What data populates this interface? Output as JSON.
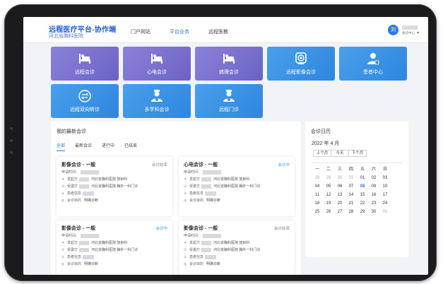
{
  "header": {
    "title": "远程医疗平台-协作端",
    "subtitle": "河北省胸科医院",
    "nav": [
      "门户网站",
      "平台业务",
      "远程医教"
    ],
    "active_nav": 1,
    "user": {
      "avatar_text": "刘",
      "dept": "会诊中心"
    }
  },
  "tiles": [
    {
      "label": "远程会诊",
      "icon": "bed-icon",
      "theme": "purple"
    },
    {
      "label": "心电会诊",
      "icon": "bed-icon",
      "theme": "purple"
    },
    {
      "label": "病理会诊",
      "icon": "bed-icon",
      "theme": "purple"
    },
    {
      "label": "远程影像会诊",
      "icon": "scan-icon",
      "theme": "blue"
    },
    {
      "label": "患者中心",
      "icon": "patient-icon",
      "theme": "blue"
    },
    {
      "label": "远程双向转诊",
      "icon": "transfer-icon",
      "theme": "blue"
    },
    {
      "label": "多学科会诊",
      "icon": "doctor-icon",
      "theme": "blue"
    },
    {
      "label": "远程门诊",
      "icon": "doctor-icon",
      "theme": "blue"
    }
  ],
  "consult": {
    "title": "我的最新会诊",
    "tabs": [
      "全部",
      "最新会诊",
      "进行中",
      "已结束"
    ],
    "active_tab": 0,
    "cards": [
      {
        "title": "影像会诊 - 一般",
        "status": "会诊结束",
        "state": "done",
        "apply_time": "申请时间：",
        "sender": "发起方",
        "sender_val": "河北省胸科医院 放射科",
        "receiver": "受邀方",
        "receiver_val": "河北省胸科医院 胸外一科门诊",
        "patient": "患者信息",
        "purpose": "会诊目的",
        "purpose_val": "明确诊断"
      },
      {
        "title": "心电会诊 - 一般",
        "status": "会诊中",
        "state": "live",
        "apply_time": "申请时间：",
        "sender": "发起方",
        "sender_val": "河北省胸科医院 放射科",
        "receiver": "受邀方",
        "receiver_val": "河北省胸科医院 胸外一科门诊",
        "patient": "患者信息",
        "purpose": "会诊目的",
        "purpose_val": "明确诊断"
      },
      {
        "title": "影像会诊 - 一般",
        "status": "会诊中",
        "state": "live",
        "apply_time": "申请时间：",
        "sender": "发起方",
        "sender_val": "河北省胸科医院 放射科",
        "receiver": "受邀方",
        "receiver_val": "河北省胸科医院 胸外一科门诊",
        "patient": "患者信息",
        "purpose": "会诊目的",
        "purpose_val": "明确诊断"
      },
      {
        "title": "影像会诊 - 一般",
        "status": "会诊结束",
        "state": "done",
        "apply_time": "申请时间：",
        "sender": "发起方",
        "sender_val": "河北省胸科医院 放射科",
        "receiver": "受邀方",
        "receiver_val": "河北省胸科医院 胸外一科门诊",
        "patient": "患者信息",
        "purpose": "会诊目的",
        "purpose_val": "明确诊断"
      }
    ]
  },
  "calendar": {
    "title": "会诊日历",
    "month": "2022 年 4 月",
    "buttons": [
      "上个月",
      "今天",
      "下个月"
    ],
    "weekdays": [
      "一",
      "二",
      "三",
      "四",
      "五",
      "六",
      "日"
    ],
    "weeks": [
      [
        "28",
        "29",
        "30",
        "31",
        "01",
        "02",
        "03"
      ],
      [
        "04",
        "05",
        "06",
        "07",
        "08",
        "09",
        "10"
      ],
      [
        "11",
        "12",
        "13",
        "14",
        "15",
        "16",
        "17"
      ],
      [
        "18",
        "19",
        "20",
        "21",
        "22",
        "23",
        "24"
      ],
      [
        "25",
        "26",
        "27",
        "28",
        "29",
        "30",
        "01"
      ]
    ],
    "today": "08"
  },
  "colors": {
    "accent": "#2f78e8",
    "purple": "#7a73cf",
    "blue": "#3a92e4"
  }
}
